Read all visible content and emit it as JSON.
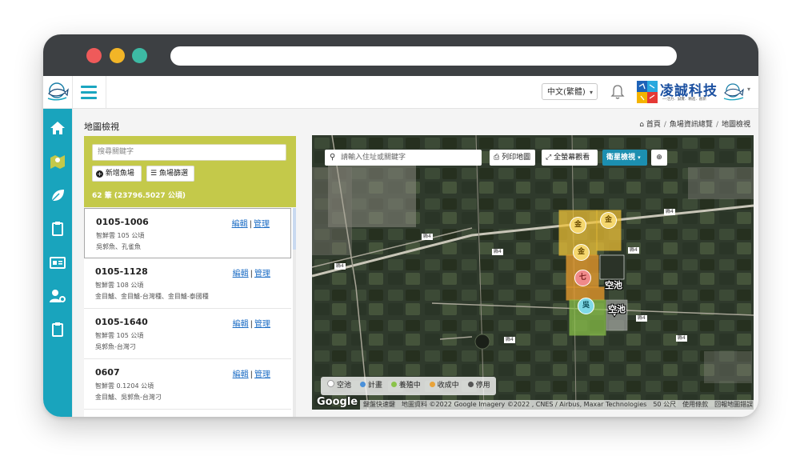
{
  "language": {
    "selected": "中文(繁體)"
  },
  "brand": {
    "name": "凌誠科技",
    "tagline": "──活力．誠實．精進．創新"
  },
  "breadcrumb": {
    "title": "地圖檢視",
    "items": [
      "首頁",
      "魚場資訊總覽",
      "地圖檢視"
    ]
  },
  "filter": {
    "search_placeholder": "搜尋關鍵字",
    "add_button": "新增魚場",
    "filter_button": "魚場篩選",
    "count": "62 筆 (23796.5027 公頃)"
  },
  "ponds": [
    {
      "code": "0105-1006",
      "area": "智鮮雲 105 公頃",
      "species": "吳郭魚、孔雀魚",
      "edit": "編輯",
      "manage": "管理"
    },
    {
      "code": "0105-1128",
      "area": "智鮮雲 108 公頃",
      "species": "金目鱸、金目鱸-台灣種、金目鱸-泰國種",
      "edit": "編輯",
      "manage": "管理"
    },
    {
      "code": "0105-1640",
      "area": "智鮮雲 105 公頃",
      "species": "吳郭魚-台灣刁",
      "edit": "編輯",
      "manage": "管理"
    },
    {
      "code": "0607",
      "area": "智鮮雲 0.1204 公頃",
      "species": "金目鱸、吳郭魚-台灣刁",
      "edit": "編輯",
      "manage": "管理"
    }
  ],
  "map": {
    "search_placeholder": "請輸入住址或關鍵字",
    "print_button": "列印地圖",
    "fullscreen_button": "全螢幕觀看",
    "layer_button": "衛星檢視",
    "markers": [
      {
        "label": "金",
        "color": "#f5d76e"
      },
      {
        "label": "金",
        "color": "#f5d76e"
      },
      {
        "label": "金",
        "color": "#f5d76e"
      },
      {
        "label": "七",
        "color": "#f08a8a"
      },
      {
        "label": "吳",
        "color": "#7fd9e6"
      }
    ],
    "pool_labels": [
      "空池",
      "空池"
    ],
    "road_labels": [
      "縣4",
      "縣4",
      "縣4",
      "縣4",
      "縣4",
      "縣4",
      "縣4",
      "縣4"
    ],
    "legend": [
      {
        "label": "空池",
        "color": "#ffffff"
      },
      {
        "label": "計畫",
        "color": "#4a90d9"
      },
      {
        "label": "養殖中",
        "color": "#8bc34a"
      },
      {
        "label": "收成中",
        "color": "#e8a33a"
      },
      {
        "label": "停用",
        "color": "#555555"
      }
    ],
    "google_logo": "Google",
    "attribution": "鍵盤快速鍵　地圖資料 ©2022 Google Imagery ©2022 , CNES / Airbus, Maxar Technologies　50 公尺　使用條款　回報地圖錯誤"
  },
  "colors": {
    "accent": "#19a4bd",
    "panel": "#c4c94a",
    "link": "#1f6fc6"
  }
}
